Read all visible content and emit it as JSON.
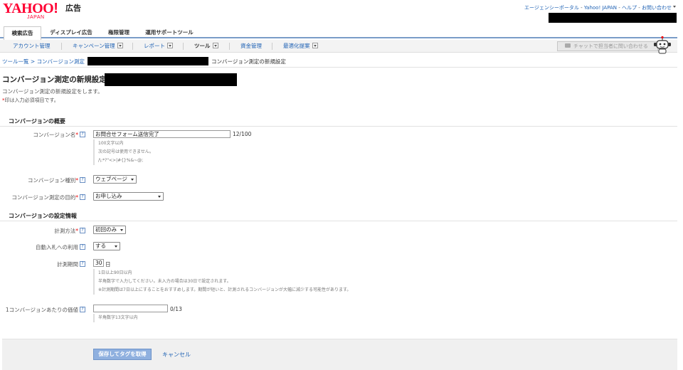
{
  "brand": {
    "logo_main": "YAHOO",
    "logo_exclaim": "!",
    "logo_sub": "JAPAN",
    "product": "広告"
  },
  "header_links": [
    "エージェンシーポータル",
    "Yahoo! JAPAN",
    "ヘルプ",
    "お問い合わせ"
  ],
  "header_link_sep": " - ",
  "main_tabs": [
    "検索広告",
    "ディスプレイ広告",
    "権限管理",
    "運用サポートツール"
  ],
  "sub_nav": {
    "account": "アカウント管理",
    "campaign": "キャンペーン管理",
    "report": "レポート",
    "tools": "ツール",
    "funds": "資金管理",
    "optimize": "最適化提案",
    "chat": "チャットで担当者に問い合わせる"
  },
  "breadcrumb": {
    "tools_list": "ツール一覧",
    "sep": " > ",
    "conversion": "コンバージョン測定",
    "current": "コンバージョン測定の新規設定"
  },
  "page": {
    "title": "コンバージョン測定の新規設定",
    "description": "コンバージョン測定の新規設定をします。",
    "required_mark": "*",
    "required_note": "印は入力必須項目です。"
  },
  "help_glyph": "?",
  "sections": {
    "overview": "コンバージョンの概要",
    "settings": "コンバージョンの設定情報"
  },
  "fields": {
    "name": {
      "label": "コンバージョン名",
      "value": "お問合せフォーム送信完了",
      "counter": "12/100",
      "hints": [
        "100文字以内",
        "次の記号は使用できません。",
        "/\\:*?\"<>|#{}%&~@;"
      ]
    },
    "type": {
      "label": "コンバージョン種別",
      "value": "ウェブページ"
    },
    "purpose": {
      "label": "コンバージョン測定の目的",
      "value": "お申し込み"
    },
    "method": {
      "label": "計測方法",
      "value": "初回のみ"
    },
    "auto_bid": {
      "label": "自動入札への利用",
      "value": "する"
    },
    "period": {
      "label": "計測期間",
      "value": "30",
      "unit": "日",
      "hints": [
        "1日以上90日以内",
        "半角数字で入力してください。未入力の場合は30日で設定されます。",
        "※計測期間は7日以上にすることをおすすめします。期間が短いと、計測されるコンバージョンが大幅に減少する可能性があります。"
      ]
    },
    "value_per_conversion": {
      "label": "1コンバージョンあたりの価値",
      "value": "",
      "counter": "0/13",
      "hints": [
        "半角数字13文字以内"
      ]
    }
  },
  "actions": {
    "save": "保存してタグを取得",
    "cancel": "キャンセル"
  }
}
